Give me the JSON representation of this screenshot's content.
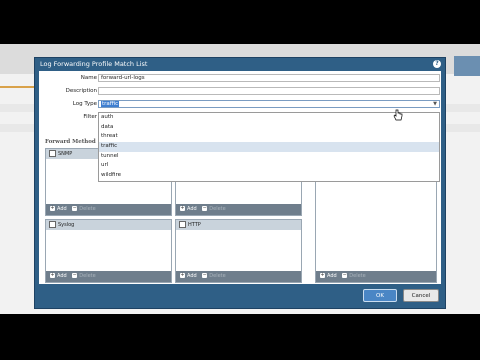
{
  "dialog": {
    "title": "Log Forwarding Profile Match List",
    "help_icon": "?"
  },
  "form": {
    "name_label": "Name",
    "name_value": "forward-url-logs",
    "description_label": "Description",
    "description_value": "",
    "logtype_label": "Log Type",
    "logtype_value": "traffic",
    "filter_label": "Filter"
  },
  "logtype_options": [
    "auth",
    "data",
    "threat",
    "traffic",
    "tunnel",
    "url",
    "wildfire"
  ],
  "logtype_selected": "traffic",
  "forward_method_label": "Forward Method",
  "panels": {
    "snmp": "SNMP",
    "syslog": "Syslog",
    "http": "HTTP",
    "add_label": "Add",
    "delete_label": "Delete"
  },
  "buttons": {
    "ok": "OK",
    "cancel": "Cancel"
  },
  "icons": {
    "help": "question-circle-icon",
    "add": "plus-icon",
    "delete": "minus-icon",
    "caret": "chevron-down-icon",
    "cursor": "hand-pointer-icon"
  }
}
